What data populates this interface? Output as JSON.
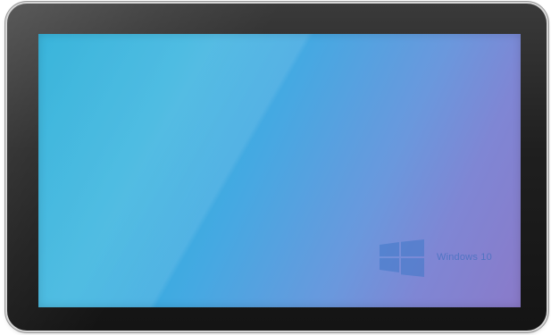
{
  "device": {
    "type": "tablet",
    "bezel_color": "#1f1f1f",
    "frame_color": "#d6d6d6"
  },
  "screen": {
    "wallpaper_gradient": [
      "#1eaad6",
      "#45a9e2",
      "#7f86d4",
      "#8a7ac9"
    ],
    "logo_icon": "windows-logo-icon",
    "logo_text": "Windows 10"
  }
}
